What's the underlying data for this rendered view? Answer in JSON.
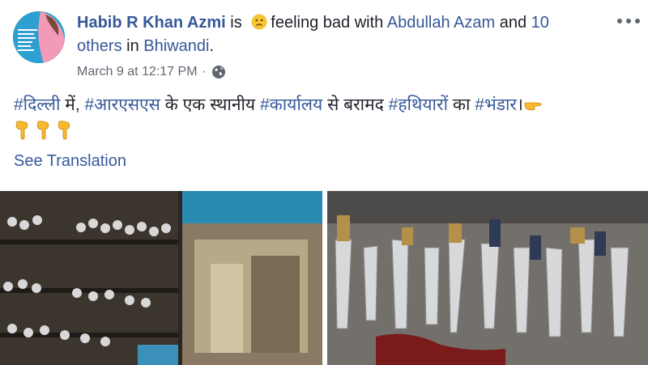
{
  "post": {
    "author_name": "Habib R Khan Azmi",
    "is_word": "is",
    "feeling_text": "feeling bad with",
    "tagged_person": "Abdullah Azam",
    "and_word": "and",
    "others": "10 others",
    "in_word": "in",
    "location": "Bhiwandi",
    "period": ".",
    "timestamp": "March 9 at 12:17 PM",
    "separator": "·",
    "privacy_icon": "globe-icon",
    "more_icon": "more-options-icon",
    "body": {
      "tag1": "#दिल्ली",
      "text1": " में, ",
      "tag2": "#आरएसएस",
      "text2": " के एक स्थानीय ",
      "tag3": "#कार्यालय",
      "text3": " से बरामद ",
      "tag4": "#हथियारों",
      "text4": " का ",
      "tag5": "#भंडार",
      "text5": "।"
    },
    "see_translation": "See Translation",
    "avatar_text": "I AM LINKAN STAND WITH ASIFA",
    "emojis": [
      "pointing-right-emoji",
      "pointing-down-emoji",
      "pointing-down-emoji",
      "pointing-down-emoji"
    ],
    "colors": {
      "link": "#365899",
      "text": "#1d2129",
      "muted": "#606770"
    }
  }
}
